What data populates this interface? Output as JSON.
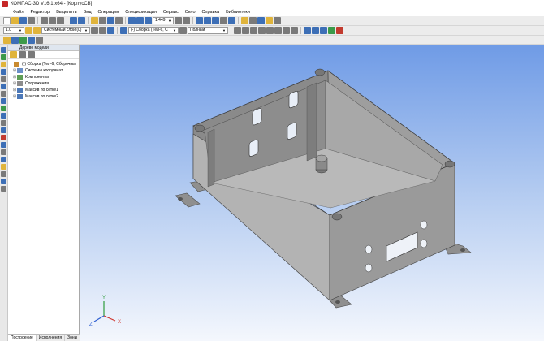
{
  "window": {
    "title": "КОМПАС-3D V16.1 x64 - [КорпусСВ]"
  },
  "menu": [
    "",
    "Файл",
    "Редактор",
    "Выделить",
    "Вид",
    "Операции",
    "Спецификация",
    "Сервис",
    "Окно",
    "Справка",
    "Библиотеки"
  ],
  "toolbar2": {
    "scale_value": "1.0",
    "layer_value": "Системный слой (0)",
    "assembly_value": "(-) Сборка (Тел-6, С",
    "style_value": "Полный",
    "zoom_value": "1.449"
  },
  "tree_panel": {
    "header": "Дерево модели",
    "items": [
      {
        "label": "(-) Сборка (Тел-6, Сборочны",
        "level": 0,
        "expander": "",
        "icon": "assembly-icon"
      },
      {
        "label": "Системы координат",
        "level": 1,
        "expander": "⊞",
        "icon": "coordinate-system-icon"
      },
      {
        "label": "Компоненты",
        "level": 1,
        "expander": "⊞",
        "icon": "components-icon"
      },
      {
        "label": "Сопряжения",
        "level": 1,
        "expander": "⊞",
        "icon": "mates-icon"
      },
      {
        "label": "Массив по сетке1",
        "level": 1,
        "expander": "⊞",
        "icon": "grid-pattern-icon"
      },
      {
        "label": "Массив по сетке2",
        "level": 1,
        "expander": "⊞",
        "icon": "grid-pattern-icon"
      }
    ],
    "tabs": [
      "Построение",
      "Исполнения",
      "Зоны"
    ]
  },
  "colors": {
    "viewport_top": "#6f9be6",
    "viewport_bottom": "#f4f7fd",
    "model_gray": "#9a9a9a",
    "axis_x": "#d0342c",
    "axis_y": "#2e9c3c",
    "axis_z": "#2f5fd0"
  },
  "triad": {
    "x": "X",
    "y": "Y",
    "z": "Z"
  }
}
